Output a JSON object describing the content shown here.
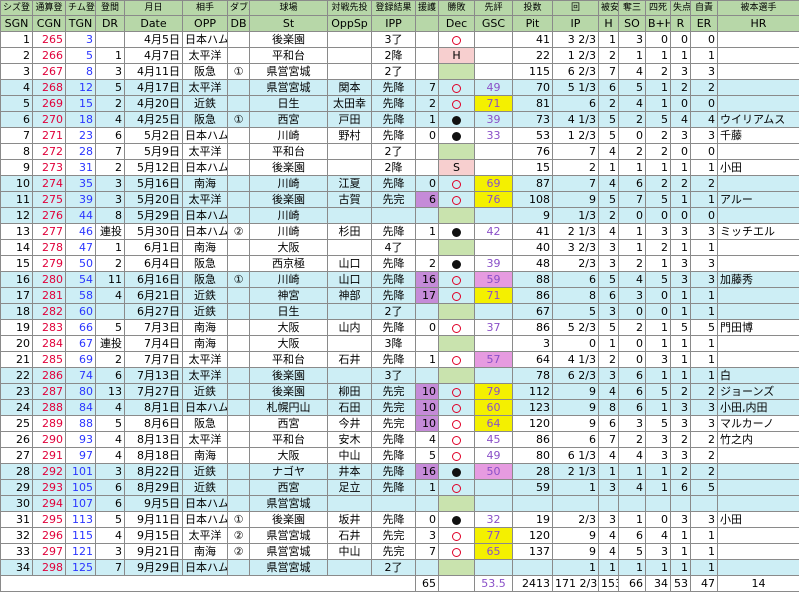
{
  "header_top": [
    "シズ登",
    "通算登",
    "チム登",
    "登間",
    "月日",
    "相手",
    "ダブル",
    "球場",
    "対戦先投",
    "登録結果",
    "援護",
    "勝敗",
    "先評",
    "投数",
    "回",
    "被安",
    "奪三",
    "四死",
    "失点",
    "自責",
    "被本選手"
  ],
  "header_main": [
    "SGN",
    "CGN",
    "TGN",
    "DR",
    "Date",
    "OPP",
    "DB",
    "St",
    "OppSp",
    "IPP",
    "",
    "Dec",
    "GSC",
    "Pit",
    "IP",
    "H",
    "SO",
    "B+H",
    "R",
    "ER",
    "HR"
  ],
  "rows": [
    [
      "1",
      "265",
      "3",
      "",
      "4月5日",
      "日本ハム",
      "",
      "後楽園",
      "",
      "3了",
      "",
      "circle",
      "",
      "41",
      "3 2/3",
      "1",
      "3",
      "0",
      "0",
      "0",
      ""
    ],
    [
      "2",
      "266",
      "5",
      "1",
      "4月7日",
      "太平洋",
      "",
      "平和台",
      "",
      "2降",
      "",
      "H",
      "",
      "22",
      "1 2/3",
      "2",
      "1",
      "1",
      "1",
      "1",
      ""
    ],
    [
      "3",
      "267",
      "8",
      "3",
      "4月11日",
      "阪急",
      "①",
      "県営宮城",
      "",
      "2了",
      "",
      "",
      "",
      "115",
      "6 2/3",
      "7",
      "4",
      "2",
      "3",
      "3",
      ""
    ],
    [
      "4",
      "268",
      "12",
      "5",
      "4月17日",
      "太平洋",
      "",
      "県営宮城",
      "関本",
      "先降",
      "7",
      "circle",
      "49",
      "70",
      "5 1/3",
      "6",
      "5",
      "1",
      "2",
      "2",
      ""
    ],
    [
      "5",
      "269",
      "15",
      "2",
      "4月20日",
      "近鉄",
      "",
      "日生",
      "太田幸",
      "先降",
      "2",
      "circle",
      "71",
      "81",
      "6",
      "2",
      "4",
      "1",
      "0",
      "0",
      ""
    ],
    [
      "6",
      "270",
      "18",
      "4",
      "4月25日",
      "阪急",
      "①",
      "西宮",
      "戸田",
      "先降",
      "1",
      "dot",
      "39",
      "73",
      "4 1/3",
      "5",
      "2",
      "5",
      "4",
      "4",
      "ウイリアムス"
    ],
    [
      "7",
      "271",
      "23",
      "6",
      "5月2日",
      "日本ハム",
      "",
      "川崎",
      "野村",
      "先降",
      "0",
      "dot",
      "33",
      "53",
      "1 2/3",
      "5",
      "0",
      "2",
      "3",
      "3",
      "千藤"
    ],
    [
      "8",
      "272",
      "28",
      "7",
      "5月9日",
      "太平洋",
      "",
      "平和台",
      "",
      "2了",
      "",
      "",
      "",
      "76",
      "7",
      "4",
      "2",
      "2",
      "0",
      "0",
      ""
    ],
    [
      "9",
      "273",
      "31",
      "2",
      "5月12日",
      "日本ハム",
      "",
      "後楽園",
      "",
      "2降",
      "",
      "S",
      "",
      "15",
      "2",
      "1",
      "1",
      "1",
      "1",
      "1",
      "小田"
    ],
    [
      "10",
      "274",
      "35",
      "3",
      "5月16日",
      "南海",
      "",
      "川崎",
      "江夏",
      "先降",
      "0",
      "circle",
      "69",
      "87",
      "7",
      "4",
      "6",
      "2",
      "2",
      "2",
      ""
    ],
    [
      "11",
      "275",
      "39",
      "3",
      "5月20日",
      "太平洋",
      "",
      "後楽園",
      "古賀",
      "先完",
      "6",
      "circle",
      "76",
      "108",
      "9",
      "5",
      "7",
      "5",
      "1",
      "1",
      "アルー"
    ],
    [
      "12",
      "276",
      "44",
      "8",
      "5月29日",
      "日本ハム",
      "",
      "川崎",
      "",
      "",
      "",
      "",
      "",
      "9",
      "1/3",
      "2",
      "0",
      "0",
      "0",
      "0",
      ""
    ],
    [
      "13",
      "277",
      "46",
      "連投",
      "5月30日",
      "日本ハム",
      "②",
      "川崎",
      "杉田",
      "先降",
      "1",
      "dot",
      "42",
      "41",
      "2 1/3",
      "4",
      "1",
      "3",
      "3",
      "3",
      "ミッチエル"
    ],
    [
      "14",
      "278",
      "47",
      "1",
      "6月1日",
      "南海",
      "",
      "大阪",
      "",
      "4了",
      "",
      "",
      "",
      "40",
      "3 2/3",
      "3",
      "1",
      "2",
      "1",
      "1",
      ""
    ],
    [
      "15",
      "279",
      "50",
      "2",
      "6月4日",
      "阪急",
      "",
      "西京極",
      "山口",
      "先降",
      "2",
      "dot",
      "39",
      "48",
      "2/3",
      "3",
      "2",
      "1",
      "3",
      "3",
      ""
    ],
    [
      "16",
      "280",
      "54",
      "11",
      "6月16日",
      "阪急",
      "①",
      "川崎",
      "山口",
      "先降",
      "16",
      "circle",
      "59",
      "88",
      "6",
      "5",
      "4",
      "5",
      "3",
      "3",
      "加藤秀"
    ],
    [
      "17",
      "281",
      "58",
      "4",
      "6月21日",
      "近鉄",
      "",
      "神宮",
      "神部",
      "先降",
      "17",
      "circle",
      "71",
      "86",
      "8",
      "6",
      "3",
      "0",
      "1",
      "1",
      ""
    ],
    [
      "18",
      "282",
      "60",
      "",
      "6月27日",
      "近鉄",
      "",
      "日生",
      "",
      "2了",
      "",
      "",
      "",
      "67",
      "5",
      "3",
      "0",
      "0",
      "1",
      "1",
      ""
    ],
    [
      "19",
      "283",
      "66",
      "5",
      "7月3日",
      "南海",
      "",
      "大阪",
      "山内",
      "先降",
      "0",
      "circle",
      "37",
      "86",
      "5 2/3",
      "5",
      "2",
      "1",
      "5",
      "5",
      "門田博"
    ],
    [
      "20",
      "284",
      "67",
      "連投",
      "7月4日",
      "南海",
      "",
      "大阪",
      "",
      "3降",
      "",
      "",
      "",
      "3",
      "0",
      "1",
      "0",
      "1",
      "1",
      "1",
      ""
    ],
    [
      "21",
      "285",
      "69",
      "2",
      "7月7日",
      "太平洋",
      "",
      "平和台",
      "石井",
      "先降",
      "1",
      "circle",
      "57",
      "64",
      "4 1/3",
      "2",
      "0",
      "3",
      "1",
      "1",
      ""
    ],
    [
      "22",
      "286",
      "74",
      "6",
      "7月13日",
      "太平洋",
      "",
      "後楽園",
      "",
      "3了",
      "",
      "",
      "",
      "78",
      "6 2/3",
      "3",
      "6",
      "1",
      "1",
      "1",
      "白"
    ],
    [
      "23",
      "287",
      "80",
      "13",
      "7月27日",
      "近鉄",
      "",
      "後楽園",
      "柳田",
      "先完",
      "10",
      "circle",
      "79",
      "112",
      "9",
      "4",
      "6",
      "5",
      "2",
      "2",
      "ジョーンズ"
    ],
    [
      "24",
      "288",
      "84",
      "4",
      "8月1日",
      "日本ハム",
      "",
      "札幌円山",
      "石田",
      "先完",
      "10",
      "circle",
      "60",
      "123",
      "9",
      "8",
      "6",
      "1",
      "3",
      "3",
      "小田,内田"
    ],
    [
      "25",
      "289",
      "88",
      "5",
      "8月6日",
      "阪急",
      "",
      "西宮",
      "今井",
      "先完",
      "10",
      "circle",
      "64",
      "120",
      "9",
      "6",
      "3",
      "5",
      "3",
      "3",
      "マルカーノ"
    ],
    [
      "26",
      "290",
      "93",
      "4",
      "8月13日",
      "太平洋",
      "",
      "平和台",
      "安木",
      "先降",
      "4",
      "circle",
      "45",
      "86",
      "6",
      "7",
      "2",
      "3",
      "2",
      "2",
      "竹之内"
    ],
    [
      "27",
      "291",
      "97",
      "4",
      "8月18日",
      "南海",
      "",
      "大阪",
      "中山",
      "先降",
      "5",
      "circle",
      "49",
      "80",
      "6 1/3",
      "4",
      "4",
      "3",
      "3",
      "2",
      ""
    ],
    [
      "28",
      "292",
      "101",
      "3",
      "8月22日",
      "近鉄",
      "",
      "ナゴヤ",
      "井本",
      "先降",
      "16",
      "dot",
      "50",
      "28",
      "2 1/3",
      "1",
      "1",
      "1",
      "2",
      "2",
      ""
    ],
    [
      "29",
      "293",
      "105",
      "6",
      "8月29日",
      "近鉄",
      "",
      "西宮",
      "足立",
      "先降",
      "1",
      "circle",
      "",
      "59",
      "1",
      "3",
      "4",
      "1",
      "6",
      "5",
      ""
    ],
    [
      "30",
      "294",
      "107",
      "6",
      "9月5日",
      "日本ハム",
      "",
      "県営宮城",
      "",
      "",
      "",
      "",
      "",
      "",
      "",
      "",
      "",
      "",
      "",
      "",
      ""
    ],
    [
      "31",
      "295",
      "113",
      "5",
      "9月11日",
      "日本ハム",
      "①",
      "後楽園",
      "坂井",
      "先降",
      "0",
      "dot",
      "32",
      "19",
      "2/3",
      "3",
      "1",
      "0",
      "3",
      "3",
      "小田"
    ],
    [
      "32",
      "296",
      "115",
      "4",
      "9月15日",
      "太平洋",
      "②",
      "県営宮城",
      "石井",
      "先完",
      "3",
      "circle",
      "77",
      "120",
      "9",
      "4",
      "6",
      "4",
      "1",
      "1",
      ""
    ],
    [
      "33",
      "297",
      "121",
      "3",
      "9月21日",
      "南海",
      "②",
      "県営宮城",
      "中山",
      "先完",
      "7",
      "circle",
      "65",
      "137",
      "9",
      "4",
      "5",
      "3",
      "1",
      "1",
      ""
    ],
    [
      "34",
      "298",
      "125",
      "7",
      "9月29日",
      "日本ハム",
      "",
      "県営宮城",
      "",
      "2了",
      "",
      "",
      "",
      "",
      "1",
      "1",
      "1",
      "1",
      "1",
      "1",
      ""
    ]
  ],
  "totals": {
    "ipp_total": "65",
    "gsc_avg": "53.5",
    "pit_total": "2413",
    "ip_total": "171 2/3",
    "h_total": "153",
    "so_total": "66",
    "bh_total": "34",
    "r_total": "53",
    "er_total": "47",
    "hr_total": "14"
  }
}
